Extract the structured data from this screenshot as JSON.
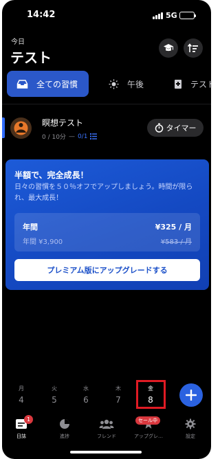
{
  "status_bar": {
    "time": "14:42",
    "network": "5G",
    "battery_level": 1.0
  },
  "header": {
    "today_label": "今日",
    "title": "テスト"
  },
  "tabs": [
    {
      "label": "全ての習慣",
      "icon": "inbox-icon",
      "active": true
    },
    {
      "label": "午後",
      "icon": "sun-icon",
      "active": false
    },
    {
      "label": "テスト",
      "icon": "notebook-icon",
      "active": false
    }
  ],
  "habit": {
    "name": "瞑想テスト",
    "progress": "0 / 10分",
    "separator": "—",
    "checklist": "0/1",
    "timer_label": "タイマー"
  },
  "promo": {
    "title": "半額で、完全成長！",
    "description": "日々の習慣を５０％オフでアップしましょう。時間が限られ、最大成長！",
    "plan_label": "年間",
    "plan_price": "¥325 / 月",
    "plan_sub": "年間 ¥3,900",
    "plan_old_price": "¥583 / 月",
    "button_label": "プレミアム版にアップグレードする"
  },
  "week": [
    {
      "weekday": "月",
      "date": "4",
      "selected": false
    },
    {
      "weekday": "火",
      "date": "5",
      "selected": false
    },
    {
      "weekday": "水",
      "date": "6",
      "selected": false
    },
    {
      "weekday": "木",
      "date": "7",
      "selected": false
    },
    {
      "weekday": "金",
      "date": "8",
      "selected": true
    }
  ],
  "bottom_nav": [
    {
      "label": "日誌",
      "icon": "journal-icon",
      "active": true,
      "badge": "1"
    },
    {
      "label": "進捗",
      "icon": "pie-chart-icon",
      "active": false
    },
    {
      "label": "フレンド",
      "icon": "friends-icon",
      "active": false
    },
    {
      "label": "アップグレ…",
      "icon": "star-icon",
      "active": false,
      "badge": "セール中"
    },
    {
      "label": "設定",
      "icon": "gear-icon",
      "active": false
    }
  ],
  "colors": {
    "accent": "#2b58c9",
    "badge": "#d9383e",
    "highlight": "#e01b24"
  }
}
